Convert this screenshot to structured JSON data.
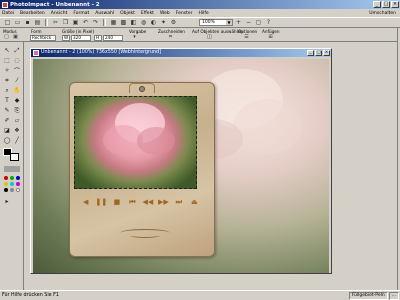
{
  "app": {
    "title": "PhotoImpact - Unbenannt - 2",
    "window_buttons": [
      "_",
      "□",
      "×"
    ]
  },
  "menu": {
    "items": [
      "Datei",
      "Bearbeiten",
      "Ansicht",
      "Format",
      "Auswahl",
      "Objekt",
      "Effekt",
      "Web",
      "Fenster",
      "Hilfe"
    ],
    "right_label": "Umschalten"
  },
  "toolbar": {
    "zoom_value": "100%"
  },
  "options": {
    "labels": {
      "modus": "Modus",
      "form": "Form",
      "groesse": "Größe (in Pixel)",
      "vorgabe": "Vorgabe",
      "zuschneiden": "Zuschneiden",
      "auf_objekten": "Auf Objekten auswählen",
      "optionen": "Optionen",
      "anfuegen": "Anfügen"
    },
    "form_value": "Rechteck",
    "width_value": "320",
    "height_value": "240"
  },
  "document": {
    "title": "Unbenannt - 2 (100%) 736x550 [Webhintergrund]"
  },
  "status": {
    "text": "Für Hilfe drücken Sie F1",
    "pane1": "Füllgebiet-Peln",
    "pane2": "..."
  },
  "colors": {
    "title_start": "#0a246a",
    "title_end": "#a6caf0",
    "chrome": "#d4d0c8",
    "control_glyph": "#a06520"
  }
}
